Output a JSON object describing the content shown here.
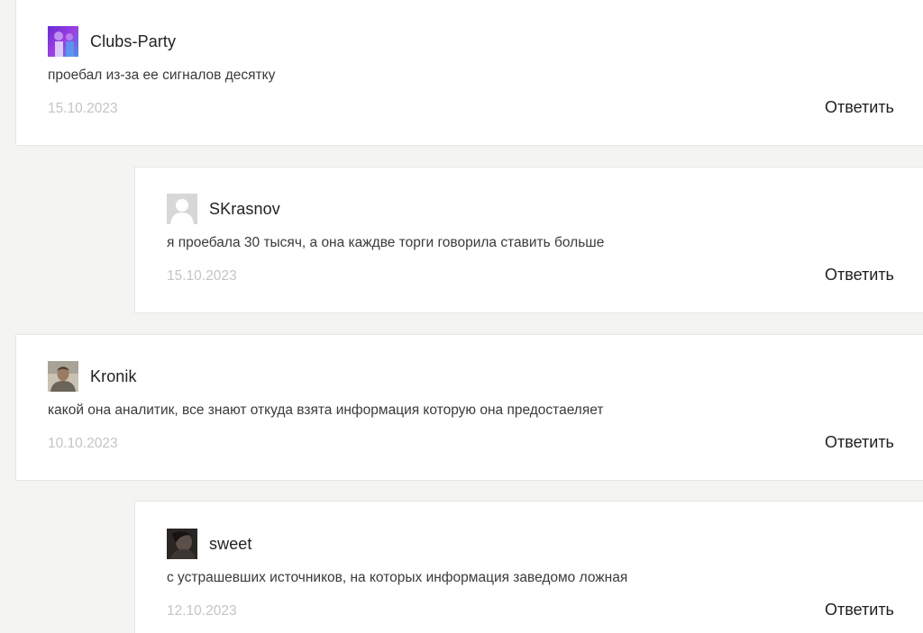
{
  "comments": [
    {
      "author": "Clubs-Party",
      "avatar": "purple-photo-avatar",
      "text": "проебал из-за ее сигналов десятку",
      "date": "15.10.2023",
      "reply_label": "Ответить"
    },
    {
      "author": "SKrasnov",
      "avatar": "default-user-avatar",
      "text": "я проебала 30 тысяч, а она каждве торги говорила ставить больше",
      "date": "15.10.2023",
      "reply_label": "Ответить"
    },
    {
      "author": "Kronik",
      "avatar": "man-photo-avatar",
      "text": "какой она аналитик, все знают откуда взята информация которую она предостаеляет",
      "date": "10.10.2023",
      "reply_label": "Ответить"
    },
    {
      "author": "sweet",
      "avatar": "dark-photo-avatar",
      "text": "с устрашевших источников, на которых информация заведомо ложная",
      "date": "12.10.2023",
      "reply_label": "Ответить"
    }
  ],
  "colors": {
    "background": "#f4f4f2",
    "card": "#ffffff",
    "date": "#c4c4c4",
    "text": "#3a3a3a"
  }
}
